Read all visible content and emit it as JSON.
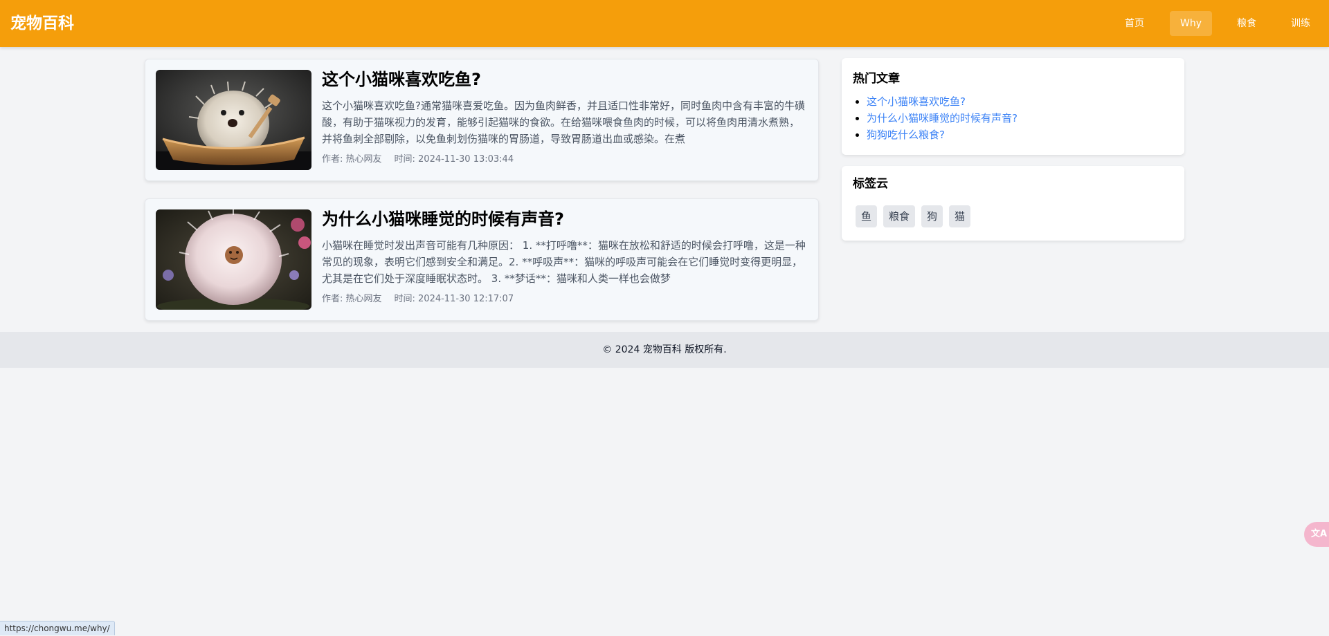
{
  "header": {
    "brand": "宠物百科",
    "nav": [
      {
        "label": "首页",
        "active": false
      },
      {
        "label": "Why",
        "active": true
      },
      {
        "label": "粮食",
        "active": false
      },
      {
        "label": "训练",
        "active": false
      }
    ]
  },
  "articles": [
    {
      "title": "这个小猫咪喜欢吃鱼?",
      "summary": "这个小猫咪喜欢吃鱼?通常猫咪喜爱吃鱼。因为鱼肉鲜香，并且适口性非常好，同时鱼肉中含有丰富的牛磺酸，有助于猫咪视力的发育，能够引起猫咪的食欲。在给猫咪喂食鱼肉的时候，可以将鱼肉用清水煮熟，并将鱼刺全部剔除，以免鱼刺划伤猫咪的胃肠道，导致胃肠道出血或感染。在煮",
      "author": "作者: 热心网友",
      "time": "时间: 2024-11-30 13:03:44",
      "image": "fluffy-creature-in-boat"
    },
    {
      "title": "为什么小猫咪睡觉的时候有声音?",
      "summary": "小猫咪在睡觉时发出声音可能有几种原因： 1. **打呼噜**：猫咪在放松和舒适的时候会打呼噜，这是一种常见的现象，表明它们感到安全和满足。2. **呼吸声**：猫咪的呼吸声可能会在它们睡觉时变得更明显，尤其是在它们处于深度睡眠状态时。 3. **梦话**：猫咪和人类一样也会做梦",
      "author": "作者: 热心网友",
      "time": "时间: 2024-11-30 12:17:07",
      "image": "fluffy-pom-creature"
    }
  ],
  "sidebar": {
    "hot": {
      "title": "热门文章",
      "items": [
        "这个小猫咪喜欢吃鱼?",
        "为什么小猫咪睡觉的时候有声音?",
        "狗狗吃什么粮食?"
      ]
    },
    "tags": {
      "title": "标签云",
      "items": [
        "鱼",
        "粮食",
        "狗",
        "猫"
      ]
    }
  },
  "footer": {
    "text": "© 2024 宠物百科 版权所有."
  },
  "status_bar": {
    "url": "https://chongwu.me/why/"
  },
  "translate_button": {
    "icon": "translate-icon",
    "glyph": "文A"
  },
  "colors": {
    "header_bg": "#f59e0b",
    "link": "#3b82f6",
    "page_bg": "#f3f4f6"
  }
}
